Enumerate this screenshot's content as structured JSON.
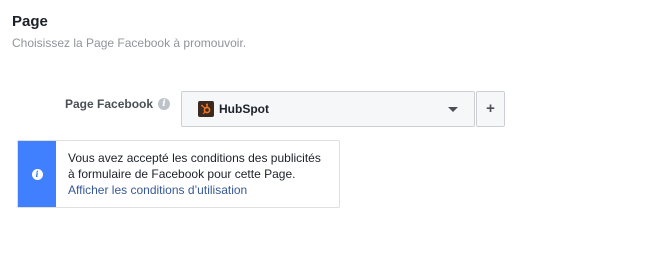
{
  "section": {
    "title": "Page",
    "subtitle": "Choisissez la Page Facebook à promouvoir."
  },
  "field": {
    "label": "Page Facebook",
    "selected_page": "HubSpot",
    "add_label": "+"
  },
  "notice": {
    "text_before_link": "Vous avez accepté les conditions des publicités à formulaire de Facebook pour cette Page.",
    "link_text": "Afficher les conditions d’utilisation",
    "accent_color": "#4080ff"
  },
  "icons": {
    "info": "info-icon",
    "dropdown": "chevron-down-icon",
    "page_logo": "hubspot-logo"
  }
}
